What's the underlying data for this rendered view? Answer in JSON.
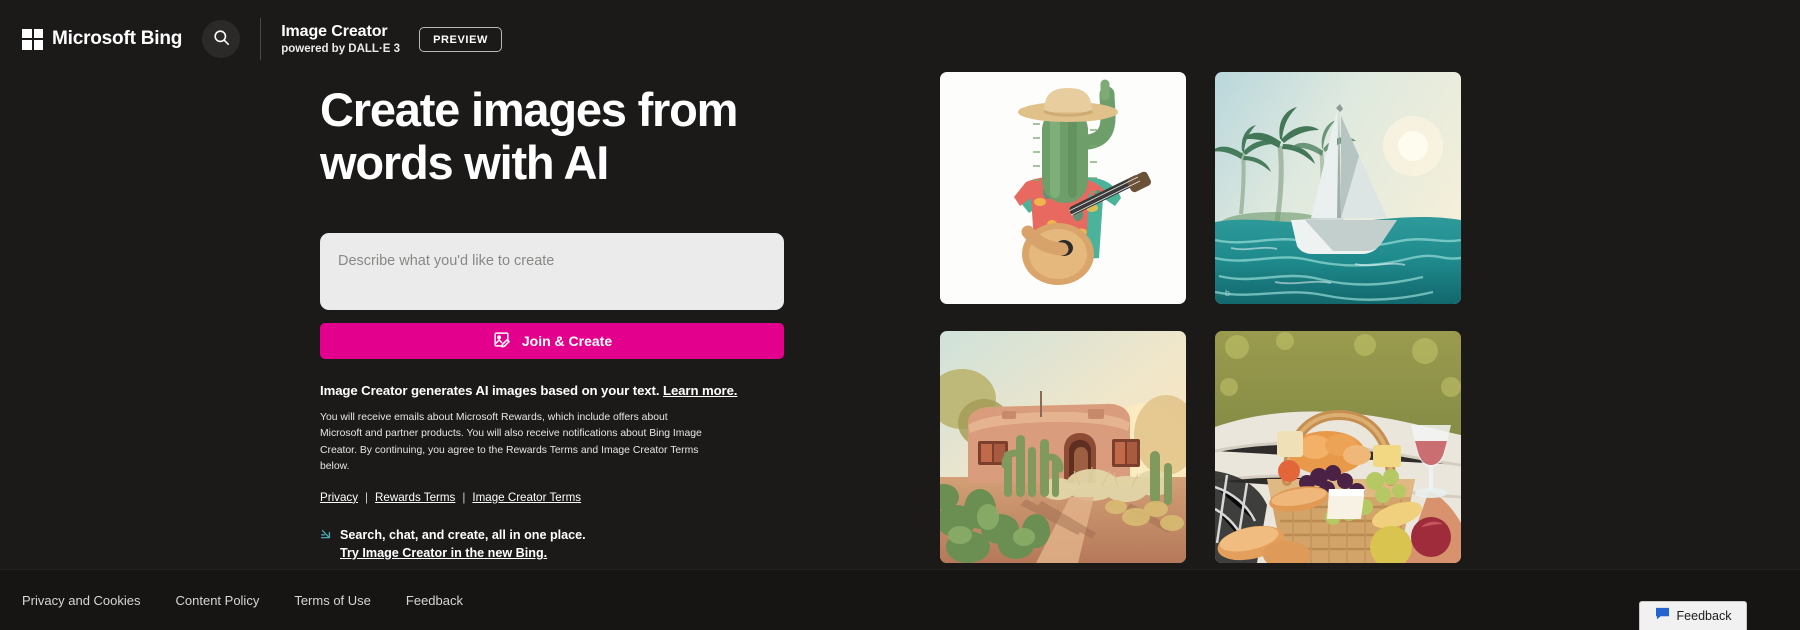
{
  "header": {
    "logo_text": "Microsoft Bing",
    "search_icon": "search-icon",
    "product_title": "Image Creator",
    "product_subtitle": "powered by DALL·E 3",
    "preview_badge": "PREVIEW"
  },
  "hero": {
    "headline": "Create images from words with AI",
    "prompt_placeholder": "Describe what you'd like to create",
    "prompt_value": "",
    "cta_label": "Join & Create",
    "cta_icon": "image-edit-icon",
    "cta_color": "#e3008c"
  },
  "disclaimer": {
    "lead": "Image Creator generates AI images based on your text.",
    "learn_more": "Learn more.",
    "fineprint": "You will receive emails about Microsoft Rewards, which include offers about Microsoft and partner products. You will also receive notifications about Bing Image Creator. By continuing, you agree to the Rewards Terms and Image Creator Terms below.",
    "links": [
      {
        "label": "Privacy"
      },
      {
        "label": "Rewards Terms"
      },
      {
        "label": "Image Creator Terms"
      }
    ],
    "separator": "|"
  },
  "promo": {
    "icon": "sparkle-arrow-icon",
    "icon_color": "#4aa8b8",
    "line1": "Search, chat, and create, all in one place.",
    "line2": "Try Image Creator in the new Bing."
  },
  "gallery": {
    "items": [
      {
        "name": "cactus-guitar-image",
        "alt": "Cactus wearing a straw sombrero and floral Hawaiian shirt playing an acoustic guitar on a white background"
      },
      {
        "name": "paper-sailboat-image",
        "alt": "Origami paper sailboat floating on turquoise ocean water with palm trees and bright sky"
      },
      {
        "name": "adobe-desert-house-image",
        "alt": "Adobe desert house at golden hour surrounded by saguaro and prickly pear cacti"
      },
      {
        "name": "picnic-basket-image",
        "alt": "Wicker picnic basket filled with bread, grapes, cheese and a glass of rosé wine on a blanket"
      }
    ]
  },
  "footer": {
    "links": [
      {
        "label": "Privacy and Cookies"
      },
      {
        "label": "Content Policy"
      },
      {
        "label": "Terms of Use"
      },
      {
        "label": "Feedback"
      }
    ]
  },
  "feedback_widget": {
    "label": "Feedback",
    "icon": "speech-bubble-icon",
    "icon_color": "#2564cf"
  }
}
